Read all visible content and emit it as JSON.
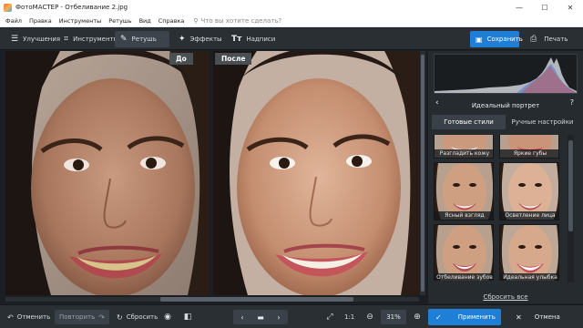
{
  "window": {
    "title": "ФотоМАСТЕР - Отбеливание 2.jpg",
    "controls": {
      "minimize": "—",
      "maximize": "☐",
      "close": "✕"
    }
  },
  "menu": {
    "items": [
      "Файл",
      "Правка",
      "Инструменты",
      "Ретушь",
      "Вид",
      "Справка"
    ],
    "search_placeholder": "Что вы хотите сделать?"
  },
  "toolbar": {
    "tabs": [
      {
        "label": "Улучшения",
        "icon": "sliders-icon",
        "active": false
      },
      {
        "label": "Инструменты",
        "icon": "crop-icon",
        "active": false
      },
      {
        "label": "Ретушь",
        "icon": "brush-icon",
        "active": true
      },
      {
        "label": "Эффекты",
        "icon": "magic-wand-icon",
        "active": false
      },
      {
        "label": "Надписи",
        "icon": "text-icon",
        "active": false
      }
    ],
    "save_label": "Сохранить",
    "print_label": "Печать"
  },
  "canvas": {
    "before_label": "До",
    "after_label": "После"
  },
  "panel": {
    "title": "Идеальный портрет",
    "tabs": [
      {
        "label": "Готовые стили",
        "active": true
      },
      {
        "label": "Ручные настройки",
        "active": false
      }
    ],
    "styles": [
      "Разгладить кожу",
      "Яркие губы",
      "Ясный взгляд",
      "Осветление лица",
      "Отбеливание зубов",
      "Идеальная улыбка"
    ],
    "reset_all": "Сбросить все"
  },
  "bottombar": {
    "undo_label": "Отменить",
    "redo_label": "Повторить",
    "reset_label": "Сбросить",
    "zoom_ratio": "1:1",
    "zoom_value": "31%",
    "apply_label": "Применить",
    "cancel_label": "Отмена"
  },
  "colors": {
    "accent": "#1f7fd6",
    "toolbar_bg": "#2a2f34",
    "panel_bg": "#262b30",
    "canvas_bg": "#1b1f23"
  }
}
